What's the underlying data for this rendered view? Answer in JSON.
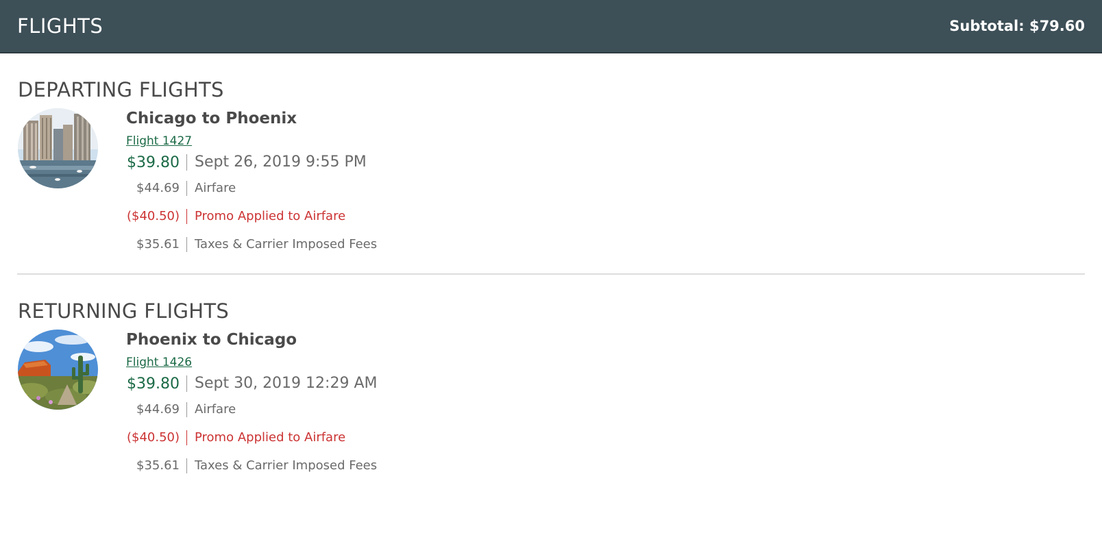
{
  "header": {
    "title": "FLIGHTS",
    "subtotal": "Subtotal: $79.60"
  },
  "colors": {
    "header_bg": "#3d4f57",
    "price_green": "#1b6a46",
    "promo_red": "#cc3333"
  },
  "departing": {
    "heading": "DEPARTING FLIGHTS",
    "route": "Chicago to Phoenix",
    "flight": "Flight 1427",
    "price": "$39.80",
    "datetime": "Sept 26, 2019 9:55 PM",
    "airfare_amount": "$44.69",
    "airfare_label": "Airfare",
    "promo_amount": "($40.50)",
    "promo_label": "Promo Applied to Airfare",
    "taxes_amount": "$35.61",
    "taxes_label": "Taxes & Carrier Imposed Fees",
    "image": "chicago-river-skyline"
  },
  "returning": {
    "heading": "RETURNING FLIGHTS",
    "route": "Phoenix to Chicago",
    "flight": "Flight 1426",
    "price": "$39.80",
    "datetime": "Sept 30, 2019 12:29 AM",
    "airfare_amount": "$44.69",
    "airfare_label": "Airfare",
    "promo_amount": "($40.50)",
    "promo_label": "Promo Applied to Airfare",
    "taxes_amount": "$35.61",
    "taxes_label": "Taxes & Carrier Imposed Fees",
    "image": "phoenix-desert-saguaro"
  }
}
